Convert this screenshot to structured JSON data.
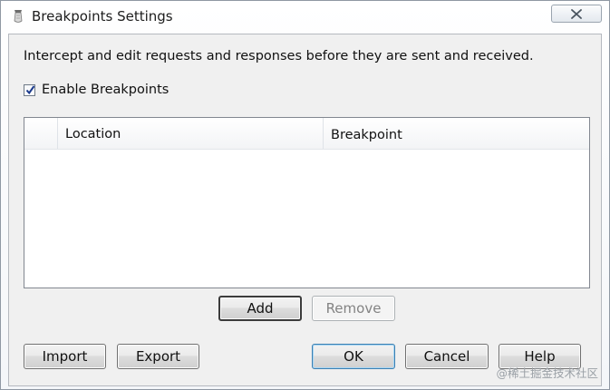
{
  "window": {
    "title": "Breakpoints Settings",
    "app_icon": "fiddler-icon",
    "close_icon": "close-icon"
  },
  "main": {
    "description": "Intercept and edit requests and responses before they are sent and received.",
    "enable_checkbox": {
      "label": "Enable Breakpoints",
      "checked": true
    },
    "table": {
      "columns": [
        "",
        "Location",
        "Breakpoint"
      ],
      "rows": []
    },
    "add_label": "Add",
    "remove_label": "Remove"
  },
  "footer": {
    "import_label": "Import",
    "export_label": "Export",
    "ok_label": "OK",
    "cancel_label": "Cancel",
    "help_label": "Help"
  },
  "watermark": "@稀土掘金技术社区",
  "colors": {
    "default_button_border": "#3c7fb1",
    "disabled_text": "#838383"
  }
}
